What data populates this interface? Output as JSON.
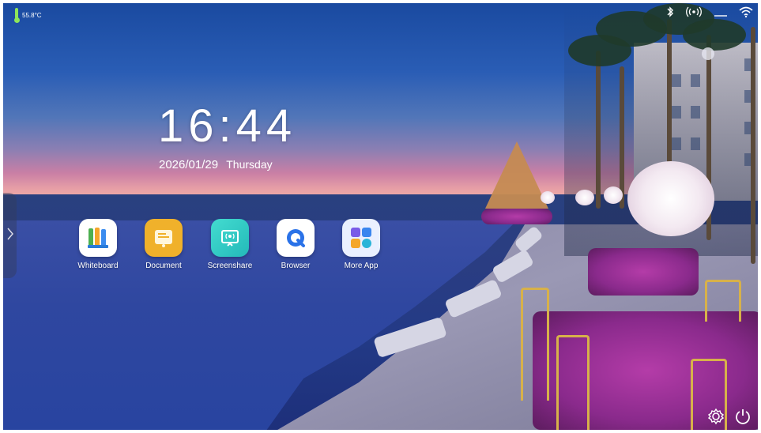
{
  "status": {
    "temperature": "55.8°C",
    "icons": [
      "bluetooth-icon",
      "hotspot-icon",
      "ethernet-icon",
      "wifi-icon"
    ]
  },
  "clock": {
    "time": "16:44",
    "date": "2026/01/29",
    "weekday": "Thursday"
  },
  "apps": [
    {
      "label": "Whiteboard",
      "icon": "whiteboard-icon"
    },
    {
      "label": "Document",
      "icon": "document-icon"
    },
    {
      "label": "Screenshare",
      "icon": "screenshare-icon"
    },
    {
      "label": "Browser",
      "icon": "browser-icon"
    },
    {
      "label": "More App",
      "icon": "more-apps-icon"
    }
  ],
  "bottom_bar": {
    "icons": [
      "settings-icon",
      "power-icon"
    ]
  },
  "side_tab": {
    "icon": "chevron-right-icon"
  },
  "colors": {
    "thermo": "#8ee65a",
    "whiteboard_bg": "#ffffff",
    "document_bg": "#f0b12b",
    "screenshare_bg": "#2fd0c8",
    "browser_bg": "#ffffff",
    "more_bg": "#eaf0ff"
  }
}
